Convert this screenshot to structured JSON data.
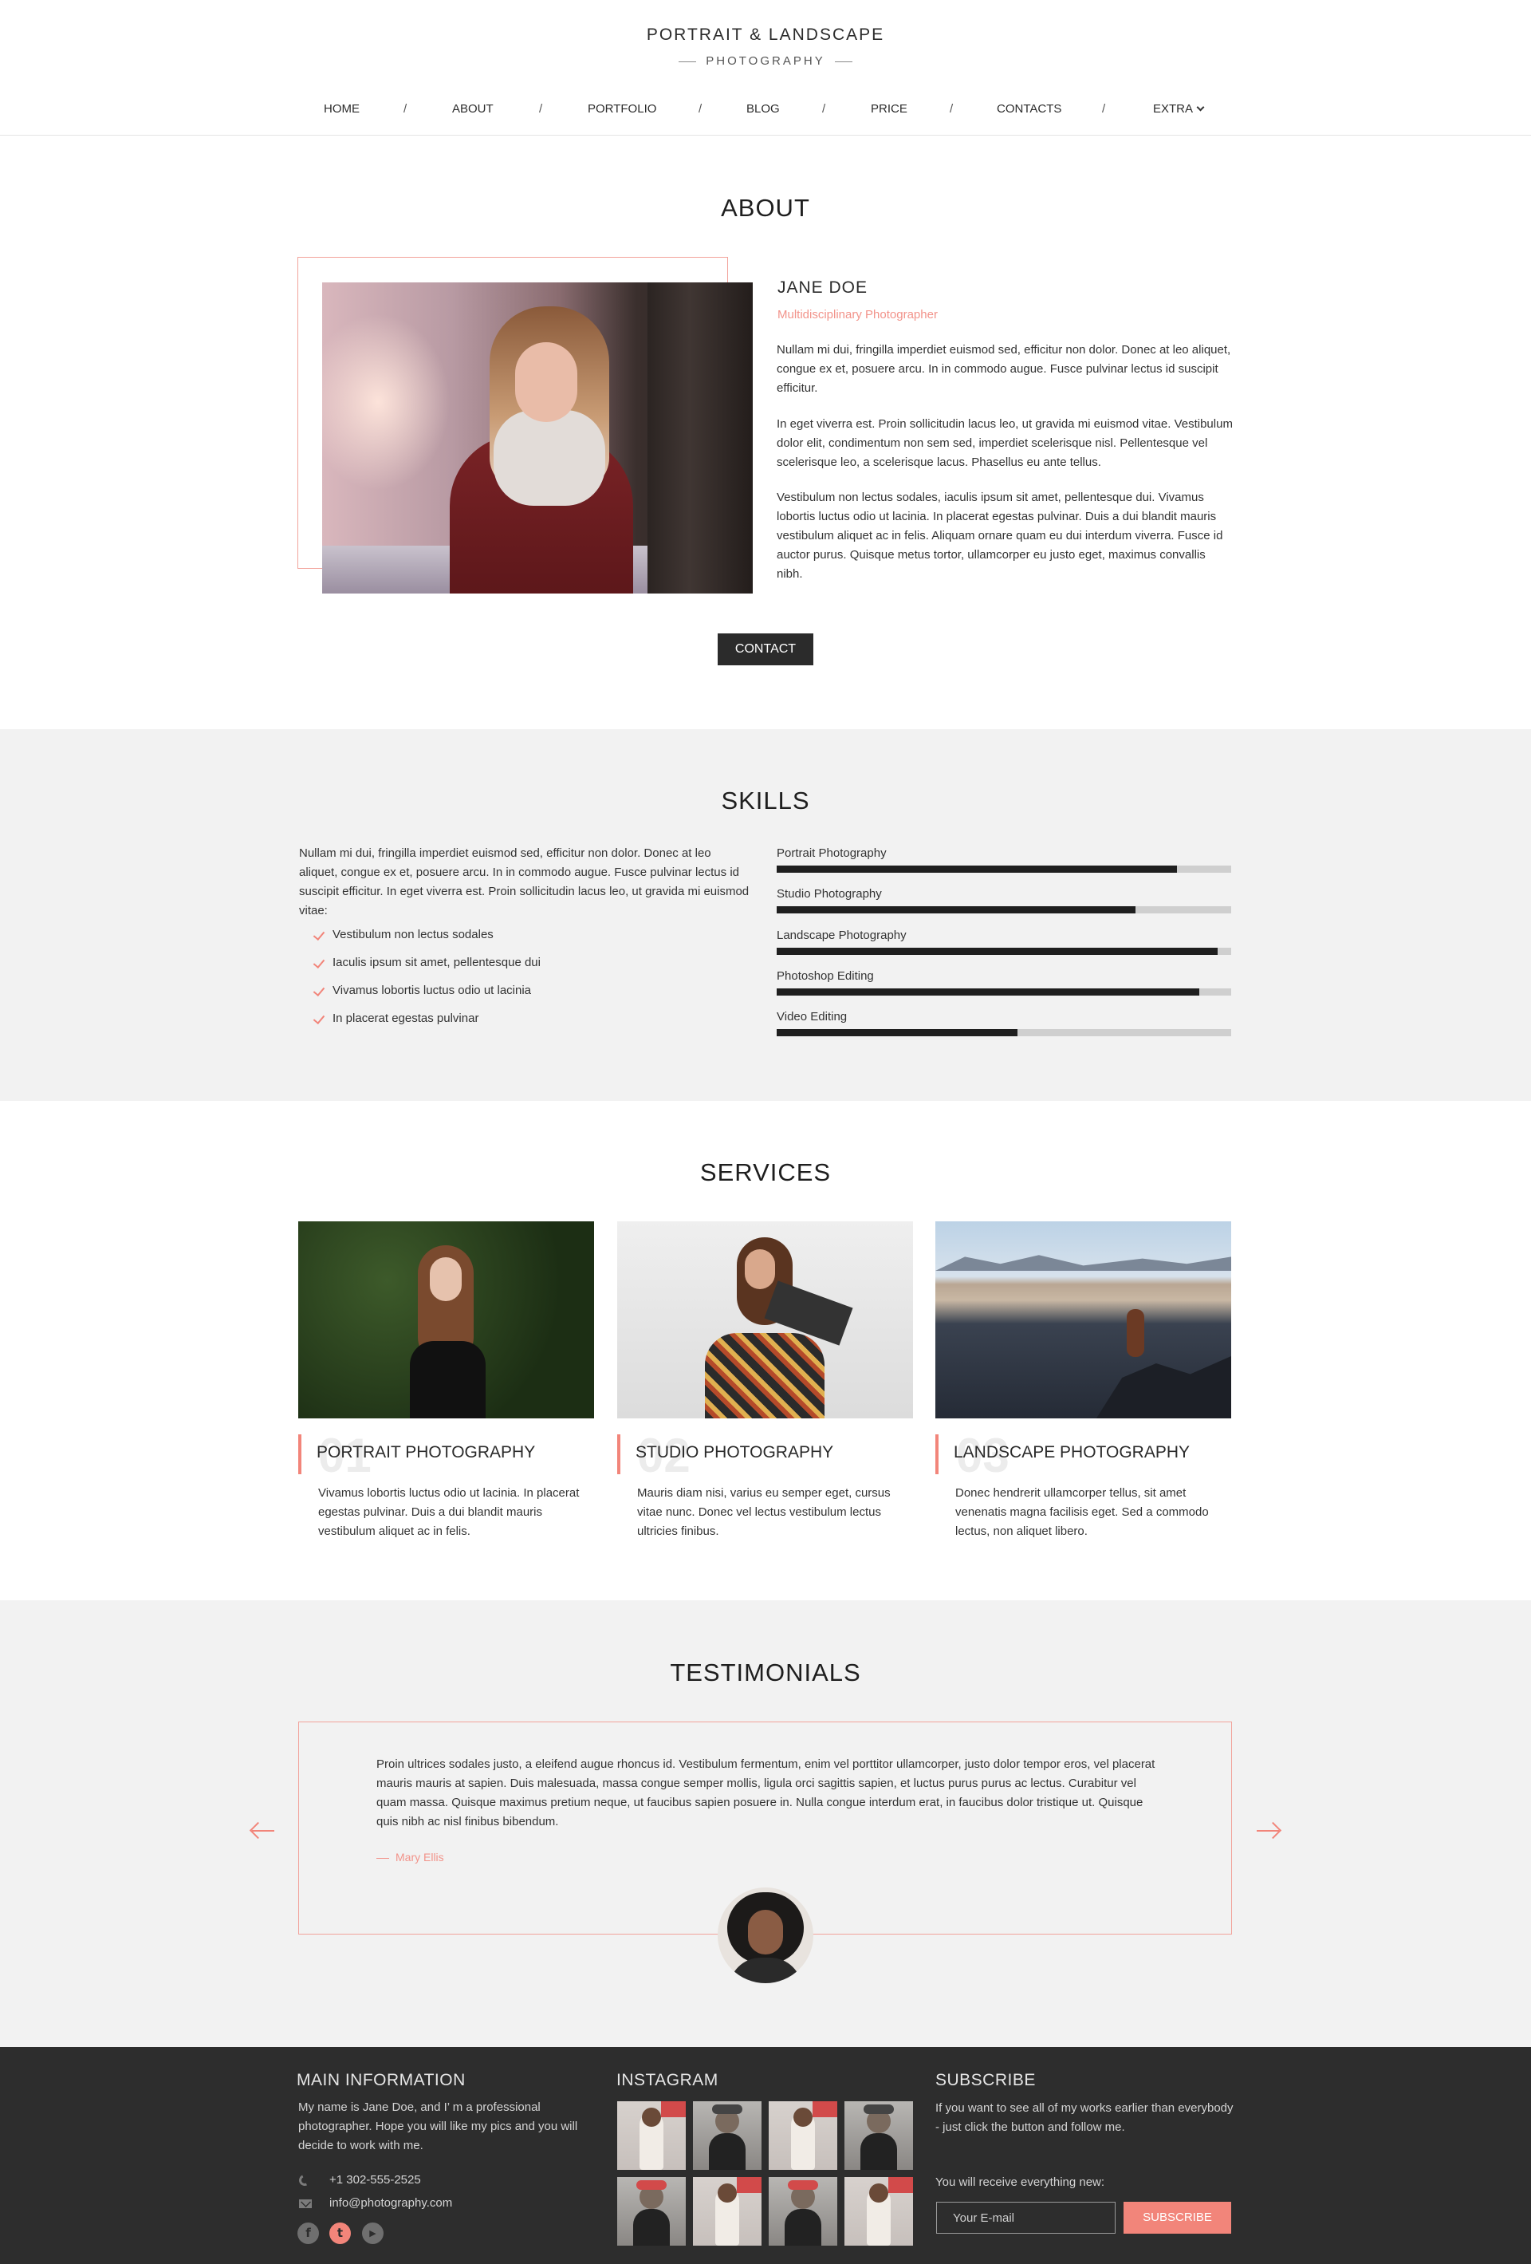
{
  "header": {
    "title": "PORTRAIT & LANDSCAPE",
    "subtitle": "PHOTOGRAPHY",
    "nav": [
      "HOME",
      "ABOUT",
      "PORTFOLIO",
      "BLOG",
      "PRICE",
      "CONTACTS",
      "EXTRA"
    ],
    "separator": "/"
  },
  "about": {
    "title": "ABOUT",
    "name": "JANE DOE",
    "role": "Multidisciplinary Photographer",
    "paragraphs": [
      "Nullam mi dui, fringilla imperdiet euismod sed, efficitur non dolor. Donec at leo aliquet, congue ex et, posuere arcu. In in commodo augue. Fusce pulvinar lectus id suscipit efficitur.",
      " In eget viverra est. Proin sollicitudin lacus leo, ut gravida mi euismod vitae. Vestibulum dolor elit, condimentum non sem sed, imperdiet scelerisque nisl. Pellentesque vel scelerisque leo, a scelerisque lacus. Phasellus eu ante tellus.",
      "Vestibulum non lectus sodales, iaculis ipsum sit amet, pellentesque dui. Vivamus lobortis luctus odio ut lacinia. In placerat egestas pulvinar. Duis a dui blandit mauris vestibulum aliquet ac in felis. Aliquam ornare quam eu dui interdum viverra. Fusce id auctor purus. Quisque metus tortor, ullamcorper eu justo eget, maximus convallis nibh."
    ],
    "button": "CONTACT"
  },
  "skills": {
    "title": "SKILLS",
    "text": "Nullam mi dui, fringilla imperdiet euismod sed, efficitur non dolor. Donec at leo aliquet, congue ex et, posuere arcu. In in commodo augue. Fusce pulvinar lectus id suscipit efficitur. In eget viverra est. Proin sollicitudin lacus leo, ut gravida mi euismod vitae:",
    "list": [
      "Vestibulum non lectus sodales",
      "Iaculis ipsum sit amet, pellentesque dui",
      "Vivamus lobortis luctus odio ut lacinia",
      "In placerat egestas pulvinar"
    ],
    "bars": [
      {
        "label": "Portrait Photography",
        "percent": 88
      },
      {
        "label": "Studio Photography",
        "percent": 79
      },
      {
        "label": "Landscape Photography",
        "percent": 97
      },
      {
        "label": "Photoshop Editing",
        "percent": 93
      },
      {
        "label": "Video Editing",
        "percent": 53
      }
    ]
  },
  "services": {
    "title": "SERVICES",
    "items": [
      {
        "num": "01",
        "title": "PORTRAIT PHOTOGRAPHY",
        "text": "Vivamus lobortis luctus odio ut lacinia. In placerat egestas pulvinar. Duis a dui blandit mauris vestibulum aliquet ac in felis."
      },
      {
        "num": "02",
        "title": "STUDIO PHOTOGRAPHY",
        "text": "Mauris diam nisi, varius eu semper eget, cursus vitae nunc. Donec vel lectus vestibulum lectus ultricies finibus."
      },
      {
        "num": "03",
        "title": "LANDSCAPE PHOTOGRAPHY",
        "text": "Donec hendrerit ullamcorper tellus, sit amet venenatis magna facilisis eget. Sed a commodo lectus, non aliquet libero."
      }
    ]
  },
  "testimonials": {
    "title": "TESTIMONIALS",
    "quote": "Proin ultrices sodales justo, a eleifend augue rhoncus id. Vestibulum fermentum, enim vel porttitor ullamcorper, justo dolor tempor eros, vel placerat mauris mauris at sapien. Duis malesuada, massa congue semper mollis, ligula orci sagittis sapien, et luctus purus purus ac lectus. Curabitur vel quam massa. Quisque maximus pretium neque, ut faucibus sapien posuere in. Nulla congue interdum erat, in faucibus dolor tristique ut. Quisque quis nibh ac nisl finibus bibendum.",
    "author": "Mary Ellis"
  },
  "footer": {
    "main_title": "MAIN INFORMATION",
    "main_text": "My name is Jane Doe, and I’ m a professional photographer. Hope you will like my pics and you will decide to work with me.",
    "phone": "+1 302-555-2525",
    "email": "info@photography.com",
    "social": [
      "facebook-icon",
      "twitter-icon",
      "youtube-icon"
    ],
    "instagram_title": "INSTAGRAM",
    "subscribe_title": "SUBSCRIBE",
    "subscribe_text": "If you want to see all of my works earlier than everybody - just click the button and follow me.",
    "subscribe_note": "You will receive everything new:",
    "email_placeholder": "Your E-mail",
    "subscribe_button": "SUBSCRIBE"
  },
  "colors": {
    "accent": "#f2857a",
    "dark": "#2b2b2b",
    "band": "#f2f2f2",
    "footer": "#2d2d2d"
  }
}
